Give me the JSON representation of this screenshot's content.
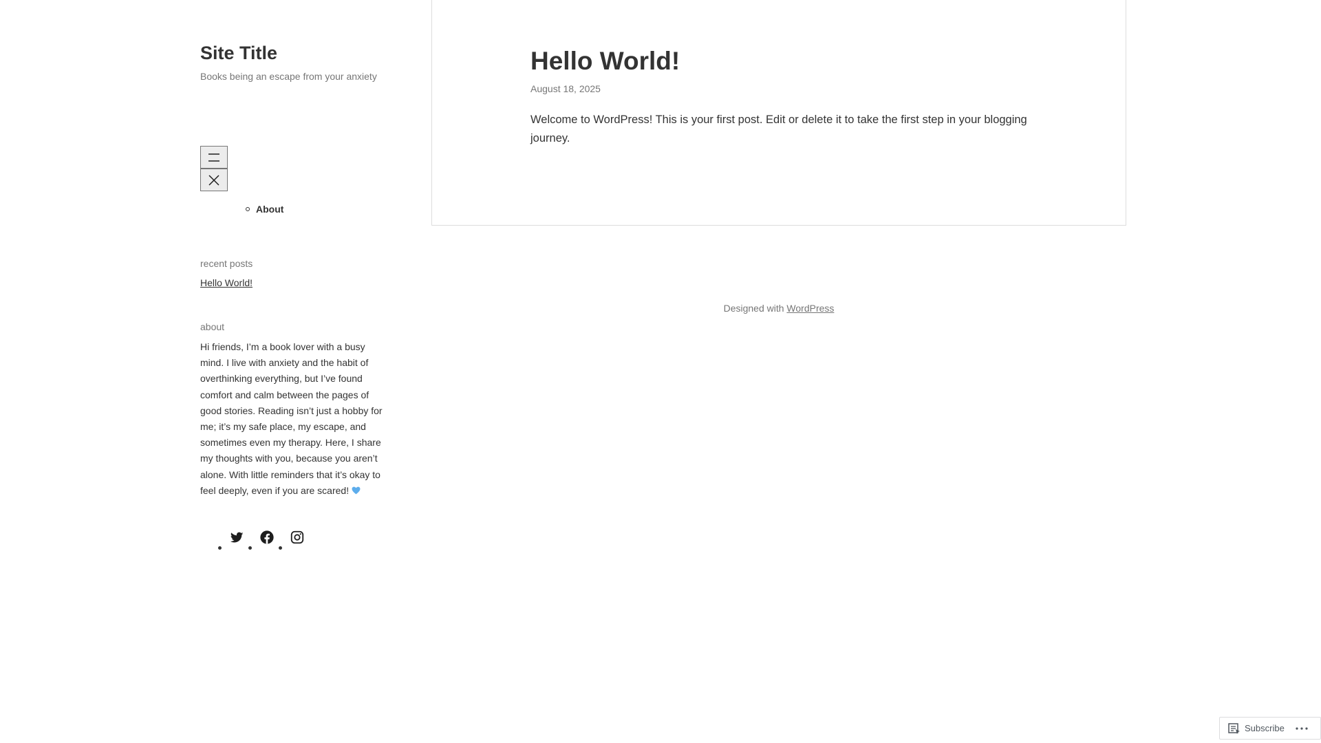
{
  "site": {
    "title": "Site Title",
    "tagline": "Books being an escape from your anxiety"
  },
  "navigation": {
    "open_menu_icon": "menu-icon",
    "close_menu_icon": "close-icon",
    "items": [
      {
        "label": "About"
      }
    ]
  },
  "widgets": {
    "recent_posts": {
      "title": "recent posts",
      "items": [
        {
          "label": "Hello World!"
        }
      ]
    },
    "about": {
      "title": "about",
      "text": "Hi friends, I’m a book lover with a busy mind. I live with anxiety and the habit of overthinking everything, but I’ve found comfort and calm between the pages of good stories. Reading isn’t just a hobby for me; it’s my safe place, my escape, and sometimes even my therapy. Here, I share my thoughts with you, because you aren’t alone. With little reminders that it’s okay to feel deeply, even if you are scared!",
      "emoji": "blue-heart-icon"
    },
    "social_links": [
      {
        "icon": "twitter-icon"
      },
      {
        "icon": "facebook-icon"
      },
      {
        "icon": "instagram-icon"
      }
    ]
  },
  "post": {
    "title": "Hello World!",
    "date": "August 18, 2025",
    "body": "Welcome to WordPress! This is your first post. Edit or delete it to take the first step in your blogging journey."
  },
  "footer": {
    "prefix": "Designed with",
    "link_label": "WordPress"
  },
  "subscribe_bar": {
    "subscribe_label": "Subscribe",
    "subscribe_icon": "reader-icon",
    "more_icon": "ellipsis-icon"
  },
  "colors": {
    "text": "#333333",
    "muted": "#767676",
    "border": "#dddddd",
    "heart": "#5DADEC"
  }
}
